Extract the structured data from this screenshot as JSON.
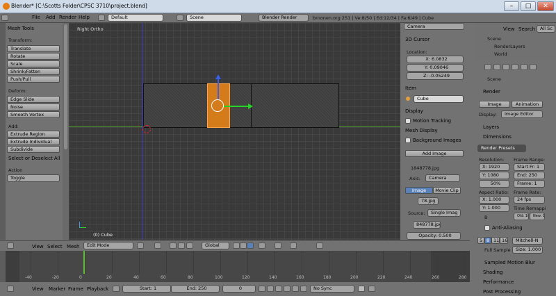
{
  "window": {
    "title": "Blender* [C:\\Scotts Folder\\CPSC 3710\\project.blend]",
    "minimize": "–",
    "maximize": "□",
    "close": "✕"
  },
  "infobar": {
    "menus": [
      "File",
      "Add",
      "Render",
      "Help"
    ],
    "screen_layout": "Default",
    "scene": "Scene",
    "engine": "Blender Render",
    "stats": "brnonen.org 251 | Ve:8/50 | Ed:12/34 | Fa:6/49 | Cube"
  },
  "toolshelf": {
    "title": "Mesh Tools",
    "transform_heading": "Transform:",
    "transform": [
      "Translate",
      "Rotate",
      "Scale",
      "Shrink/Fatten",
      "Push/Pull"
    ],
    "deform_heading": "Deform:",
    "deform": [
      "Edge Slide",
      "Noise",
      "Smooth Vertex"
    ],
    "add_heading": "Add:",
    "add": [
      "Extrude Region",
      "Extrude Individual",
      "Subdivide"
    ],
    "select_section": "Select or Deselect All",
    "action_label": "Action",
    "action_value": "Toggle"
  },
  "viewport": {
    "view_label": "Right Ortho",
    "object_label": "(0) Cube"
  },
  "props_panel": {
    "camera_tab": "Camera",
    "cursor_title": "3D Cursor",
    "location_label": "Location:",
    "x": "X: 6.0832",
    "y": "Y: 0.09046",
    "z": "Z: -0.05249",
    "item_title": "Item",
    "item_name": "Cube",
    "display": "Display",
    "motion_tracking": "Motion Tracking",
    "mesh_display": "Mesh Display",
    "background_images": "Background Images",
    "add_image": "Add Image",
    "image_name": "1848778.jpg",
    "axis_label": "Axis:",
    "axis_value": "Camera",
    "source_image": "Image",
    "source_movie": "Movie Clip",
    "image_file": "78.jpg",
    "source_label": "Source:",
    "source_value": "Single Imag",
    "file_path": "848778.jpg",
    "opacity": "Opacity: 0.500"
  },
  "outliner": {
    "menus": [
      "View",
      "Search",
      "All Sc"
    ],
    "items": [
      "Scene",
      "RenderLayers",
      "World"
    ]
  },
  "properties": {
    "breadcrumb": "Scene",
    "render_title": "Render",
    "image_btn": "Image",
    "animation_btn": "Animation",
    "display_label": "Display:",
    "display_value": "Image Editor",
    "layers": "Layers",
    "dimensions": "Dimensions",
    "render_presets": "Render Presets",
    "resolution_label": "Resolution:",
    "res_x": "X: 1920",
    "res_y": "Y: 1080",
    "res_pct": "50%",
    "frame_range_label": "Frame Range:",
    "start": "Start Fr: 1",
    "end": "End: 250",
    "frame_step": "Frame: 1",
    "aspect_label": "Aspect Ratio:",
    "aspect_x": "X: 1.000",
    "aspect_y": "Y: 1.000",
    "frame_rate_label": "Frame Rate:",
    "fps": "24 fps",
    "time_remap": "Time Remappi",
    "old": "Old: 100",
    "new": "New: 100",
    "b_label": "B",
    "anti_aliasing": "Anti-Aliasing",
    "aa_values": [
      "5",
      "8",
      "11",
      "16"
    ],
    "filter": "Mitchell-N",
    "full_sample": "Full Sample",
    "filter_size": "Size: 1.000",
    "sampled_motion_blur": "Sampled Motion Blur",
    "shading": "Shading",
    "performance": "Performance",
    "post_processing": "Post Processing"
  },
  "view_header": {
    "menus": [
      "View",
      "Select",
      "Mesh"
    ],
    "mode": "Edit Mode",
    "orientation": "Global"
  },
  "timeline": {
    "ticks": [
      "-40",
      "-20",
      "0",
      "20",
      "40",
      "60",
      "80",
      "100",
      "120",
      "140",
      "160",
      "180",
      "200",
      "220",
      "240",
      "260",
      "280"
    ],
    "current_frame": "1"
  },
  "timeline_header": {
    "menus": [
      "View",
      "Marker",
      "Frame",
      "Playback"
    ],
    "start": "Start: 1",
    "end": "End: 250",
    "frame": "0",
    "sync": "No Sync"
  }
}
